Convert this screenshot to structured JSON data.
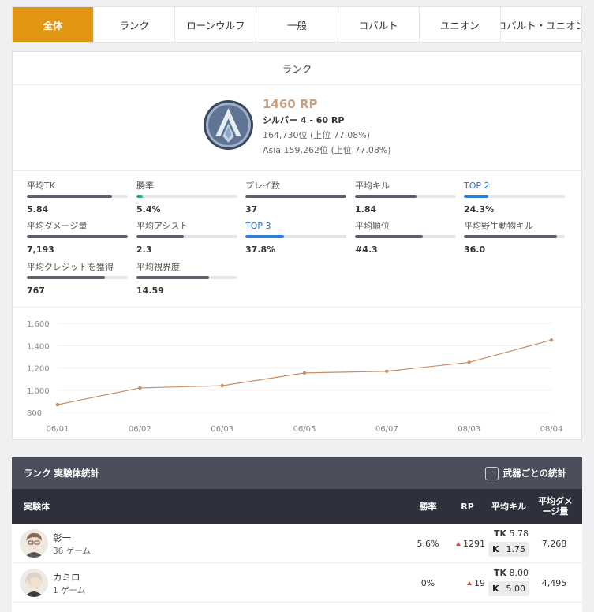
{
  "tabs": [
    {
      "label": "全体",
      "active": true
    },
    {
      "label": "ランク"
    },
    {
      "label": "ローンウルフ"
    },
    {
      "label": "一般"
    },
    {
      "label": "コバルト"
    },
    {
      "label": "ユニオン"
    },
    {
      "label": "コバルト・ユニオン"
    }
  ],
  "rank_card": {
    "title": "ランク",
    "rp": "1460 RP",
    "tier": "シルバー 4 - 60 RP",
    "global_rank": "164,730位 (上位 77.08%)",
    "region_rank": "Asia 159,262位 (上位 77.08%)"
  },
  "stats": [
    {
      "label": "平均TK",
      "value": "5.84",
      "fill_pct": 84,
      "color": "gray"
    },
    {
      "label": "勝率",
      "value": "5.4%",
      "fill_pct": 6,
      "color": "green"
    },
    {
      "label": "プレイ数",
      "value": "37",
      "fill_pct": 100,
      "color": "gray"
    },
    {
      "label": "平均キル",
      "value": "1.84",
      "fill_pct": 61,
      "color": "gray"
    },
    {
      "label": "TOP 2",
      "value": "24.3%",
      "fill_pct": 24,
      "color": "blue"
    },
    {
      "label": "平均ダメージ量",
      "value": "7,193",
      "fill_pct": 100,
      "color": "gray"
    },
    {
      "label": "平均アシスト",
      "value": "2.3",
      "fill_pct": 47,
      "color": "gray"
    },
    {
      "label": "TOP 3",
      "value": "37.8%",
      "fill_pct": 38,
      "color": "blue"
    },
    {
      "label": "平均順位",
      "value": "#4.3",
      "fill_pct": 67,
      "color": "gray"
    },
    {
      "label": "平均野生動物キル",
      "value": "36.0",
      "fill_pct": 92,
      "color": "gray"
    },
    {
      "label": "平均クレジットを獲得",
      "value": "767",
      "fill_pct": 77,
      "color": "gray"
    },
    {
      "label": "平均視界度",
      "value": "14.59",
      "fill_pct": 72,
      "color": "gray"
    }
  ],
  "chart_data": {
    "type": "line",
    "categories": [
      "06/01",
      "06/02",
      "06/03",
      "06/05",
      "06/07",
      "08/03",
      "08/04"
    ],
    "series": [
      {
        "values": [
          870,
          1020,
          1040,
          1155,
          1170,
          1250,
          1450
        ]
      }
    ],
    "ylim": [
      800,
      1600
    ],
    "yticks": [
      "1,600",
      "1,400",
      "1,200",
      "1,000",
      "800"
    ],
    "color": "#c98d65"
  },
  "table": {
    "title": "ランク 実験体統計",
    "checkbox_label": "武器ごとの統計",
    "columns": {
      "character": "実験体",
      "winrate": "勝率",
      "rp": "RP",
      "avg_kill": "平均キル",
      "avg_damage_1": "平均ダメ",
      "avg_damage_2": "ージ量"
    },
    "rows": [
      {
        "name": "彰一",
        "games": "36 ゲーム",
        "winrate": "5.6%",
        "rp": "1291",
        "tk_label": "TK",
        "tk": "5.78",
        "k_label": "K",
        "k": "1.75",
        "damage": "7,268"
      },
      {
        "name": "カミロ",
        "games": "1 ゲーム",
        "winrate": "0%",
        "rp": "19",
        "tk_label": "TK",
        "tk": "8.00",
        "k_label": "K",
        "k": "5.00",
        "damage": "4,495"
      }
    ]
  }
}
